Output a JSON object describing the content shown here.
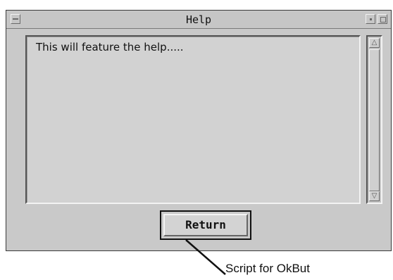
{
  "window": {
    "title": "Help"
  },
  "help_text": {
    "content": "This will feature the help....."
  },
  "scrollbar": {
    "up_arrow": "△",
    "down_arrow": "▽"
  },
  "return_button": {
    "label": "Return"
  },
  "annotation": {
    "label": "Script for OkBut"
  }
}
